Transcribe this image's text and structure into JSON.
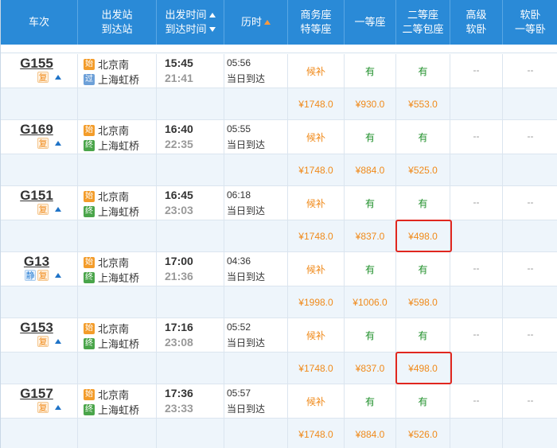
{
  "header": {
    "train": "车次",
    "station_1": "出发站",
    "station_2": "到达站",
    "time_1": "出发时间",
    "time_2": "到达时间",
    "duration": "历时",
    "business_1": "商务座",
    "business_2": "特等座",
    "first": "一等座",
    "second_1": "二等座",
    "second_2": "二等包座",
    "soft_1": "高级",
    "soft_2": "软卧",
    "soft_3": "软卧",
    "soft_4": "一等卧"
  },
  "colors": {
    "header_bg": "#2a8ad7",
    "price_row_bg": "#eef5fb",
    "accent_orange": "#f08a1a",
    "available_green": "#1f8f2a",
    "highlight_red": "#e0271f"
  },
  "trains": [
    {
      "no": "G155",
      "badges": [
        "复"
      ],
      "from_icon": "始",
      "from": "北京南",
      "to_icon": "过",
      "to": "上海虹桥",
      "dep": "15:45",
      "arr": "21:41",
      "dur": "05:56",
      "arrive_note": "当日到达",
      "business": "候补",
      "first": "有",
      "second": "有",
      "soft_hi": "--",
      "soft": "--",
      "price_business": "¥1748.0",
      "price_first": "¥930.0",
      "price_second": "¥553.0"
    },
    {
      "no": "G169",
      "badges": [
        "复"
      ],
      "from_icon": "始",
      "from": "北京南",
      "to_icon": "终",
      "to": "上海虹桥",
      "dep": "16:40",
      "arr": "22:35",
      "dur": "05:55",
      "arrive_note": "当日到达",
      "business": "候补",
      "first": "有",
      "second": "有",
      "soft_hi": "--",
      "soft": "--",
      "price_business": "¥1748.0",
      "price_first": "¥884.0",
      "price_second": "¥525.0"
    },
    {
      "no": "G151",
      "badges": [
        "复"
      ],
      "from_icon": "始",
      "from": "北京南",
      "to_icon": "终",
      "to": "上海虹桥",
      "dep": "16:45",
      "arr": "23:03",
      "dur": "06:18",
      "arrive_note": "当日到达",
      "business": "候补",
      "first": "有",
      "second": "有",
      "soft_hi": "--",
      "soft": "--",
      "price_business": "¥1748.0",
      "price_first": "¥837.0",
      "price_second": "¥498.0"
    },
    {
      "no": "G13",
      "badges": [
        "静",
        "复"
      ],
      "from_icon": "始",
      "from": "北京南",
      "to_icon": "终",
      "to": "上海虹桥",
      "dep": "17:00",
      "arr": "21:36",
      "dur": "04:36",
      "arrive_note": "当日到达",
      "business": "候补",
      "first": "有",
      "second": "有",
      "soft_hi": "--",
      "soft": "--",
      "price_business": "¥1998.0",
      "price_first": "¥1006.0",
      "price_second": "¥598.0"
    },
    {
      "no": "G153",
      "badges": [
        "复"
      ],
      "from_icon": "始",
      "from": "北京南",
      "to_icon": "终",
      "to": "上海虹桥",
      "dep": "17:16",
      "arr": "23:08",
      "dur": "05:52",
      "arrive_note": "当日到达",
      "business": "候补",
      "first": "有",
      "second": "有",
      "soft_hi": "--",
      "soft": "--",
      "price_business": "¥1748.0",
      "price_first": "¥837.0",
      "price_second": "¥498.0"
    },
    {
      "no": "G157",
      "badges": [
        "复"
      ],
      "from_icon": "始",
      "from": "北京南",
      "to_icon": "终",
      "to": "上海虹桥",
      "dep": "17:36",
      "arr": "23:33",
      "dur": "05:57",
      "arrive_note": "当日到达",
      "business": "候补",
      "first": "有",
      "second": "有",
      "soft_hi": "--",
      "soft": "--",
      "price_business": "¥1748.0",
      "price_first": "¥884.0",
      "price_second": "¥526.0"
    }
  ]
}
